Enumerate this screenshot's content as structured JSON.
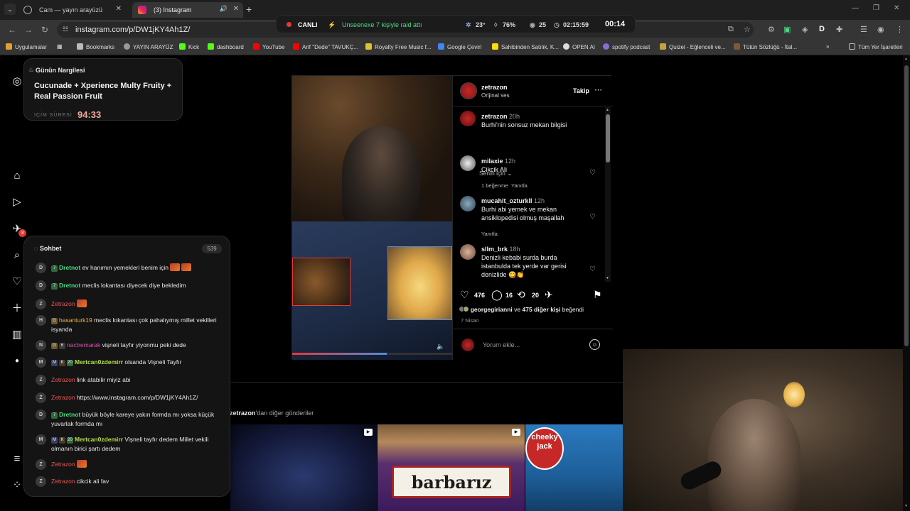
{
  "browser": {
    "tabs": [
      {
        "title": "Cam — yayın arayüzü",
        "active": false
      },
      {
        "title": "(3) Instagram",
        "active": true
      }
    ],
    "url": "instagram.com/p/DW1jKY4Ah1Z/",
    "bookmarks": [
      "Uygulamalar",
      "Bookmarks",
      "YAYIN ARAYÜZ",
      "Kick",
      "dashboard",
      "YouTube",
      "Arif \"Dede\" TAVUKÇ...",
      "Royalty Free Music f...",
      "Google Çeviri",
      "Sahibinden Satılık, K...",
      "OPEN AI",
      "spotify podcast",
      "Quizei - Eğlenceli ve...",
      "Tütün Sözlüğü - İtal...",
      "Tüm Yer İşaretleri"
    ]
  },
  "stream_status": {
    "live_label": "CANLI",
    "raid_text": "Unseenexe 7 kişiyle raid attı",
    "temperature": "23°",
    "humidity": "76%",
    "viewers": "25",
    "uptime": "02:15:59",
    "clock": "00:14"
  },
  "nargile": {
    "header": "Günün Nargilesi",
    "name": "Cucunade + Xperience Multy Fruity + Real Passion Fruit",
    "label": "İÇİM SÜRESİ",
    "time": "94:33"
  },
  "rail": {
    "notification_count": "3"
  },
  "post": {
    "author": "zetrazon",
    "audio": "Orijinal ses",
    "follow_label": "Takip",
    "caption": {
      "user": "zetrazon",
      "time": "20h",
      "text": "Burhi'nin sonsuz mekan bilgisi"
    },
    "sort_label": "Senin için",
    "comments": [
      {
        "user": "milaxie",
        "time": "12h",
        "text": "Cikcik Ali",
        "likes": "1 beğenme",
        "reply": "Yanıtla"
      },
      {
        "user": "mucahit_ozturkll",
        "time": "12h",
        "text": "Burhi abi yemek ve mekan ansiklopedisi olmuş maşallah",
        "reply": "Yanıtla"
      },
      {
        "user": "sllm_brk",
        "time": "18h",
        "text": "Denizli kebabi surda burda istanbulda tek yerde var gerisi denizlide 😋👏"
      }
    ],
    "like_count": "476",
    "comment_count": "16",
    "repost_count": "20",
    "liked_by_user": "georgegirianni",
    "liked_by_rest": "475 diğer kişi",
    "liked_by_mid": "ve",
    "liked_by_end": "beğendi",
    "date": "7 Nisan",
    "comment_placeholder": "Yorum ekle...",
    "video_progress": 0.59
  },
  "more_posts": {
    "author": "zetrazon",
    "suffix": "'dan diğer gönderiler",
    "thumb2_text": "barbarız",
    "thumb3_text": "cheeky jack"
  },
  "chat": {
    "title": "Sohbet",
    "count": "539",
    "messages": [
      {
        "av": "D",
        "badges": [
          "7"
        ],
        "user": "Dretnot",
        "cls": "u-dret",
        "text": "ev hanımın yemekleri benim için",
        "emotes": 2
      },
      {
        "av": "D",
        "badges": [
          "7"
        ],
        "user": "Dretnot",
        "cls": "u-dret",
        "text": "meclis lokantası diyecek diye bekledim",
        "emotes": 0
      },
      {
        "av": "Z",
        "badges": [],
        "user": "Zetrazon",
        "cls": "u-zet",
        "text": "",
        "emotes": 1
      },
      {
        "av": "H",
        "badges": [
          "G"
        ],
        "user": "hasanturk19",
        "cls": "u-has",
        "text": "meclis lokantası çok pahalıymış millet vekilleri isyanda",
        "emotes": 0
      },
      {
        "av": "N",
        "badges": [
          "G",
          "6"
        ],
        "user": "nactremarak",
        "cls": "u-nac",
        "text": "vişneli tayfır yiyonmu peki dede",
        "emotes": 0
      },
      {
        "av": "M",
        "badges": [
          "M",
          "K",
          "20"
        ],
        "user": "Mertcan0zdemirr",
        "cls": "u-mer",
        "text": "olsanda Vişneli Tayfır",
        "emotes": 0
      },
      {
        "av": "Z",
        "badges": [],
        "user": "Zetrazon",
        "cls": "u-zet",
        "text": "link atabilir miyiz abi",
        "emotes": 0
      },
      {
        "av": "Z",
        "badges": [],
        "user": "Zetrazon",
        "cls": "u-zet",
        "text": "https://www.instagram.com/p/DW1jKY4Ah1Z/",
        "emotes": 0
      },
      {
        "av": "D",
        "badges": [
          "7"
        ],
        "user": "Dretnot",
        "cls": "u-dret",
        "text": "büyük böyle kareye yakın formda mı yoksa küçük yuvarlak formda mı",
        "emotes": 0
      },
      {
        "av": "M",
        "badges": [
          "M",
          "K",
          "20"
        ],
        "user": "Mertcan0zdemirr",
        "cls": "u-mer",
        "text": "Vişneli tayfır dedem Millet vekili olmanın birici şartı dedem",
        "emotes": 0
      },
      {
        "av": "Z",
        "badges": [],
        "user": "Zetrazon",
        "cls": "u-zet",
        "text": "",
        "emotes": 1
      },
      {
        "av": "Z",
        "badges": [],
        "user": "Zetrazon",
        "cls": "u-zet",
        "text": "cikcik ali fav",
        "emotes": 0
      }
    ]
  },
  "colors": {
    "live": "#e53935",
    "raid": "#4ade80",
    "timer": "#f4a6a0"
  }
}
